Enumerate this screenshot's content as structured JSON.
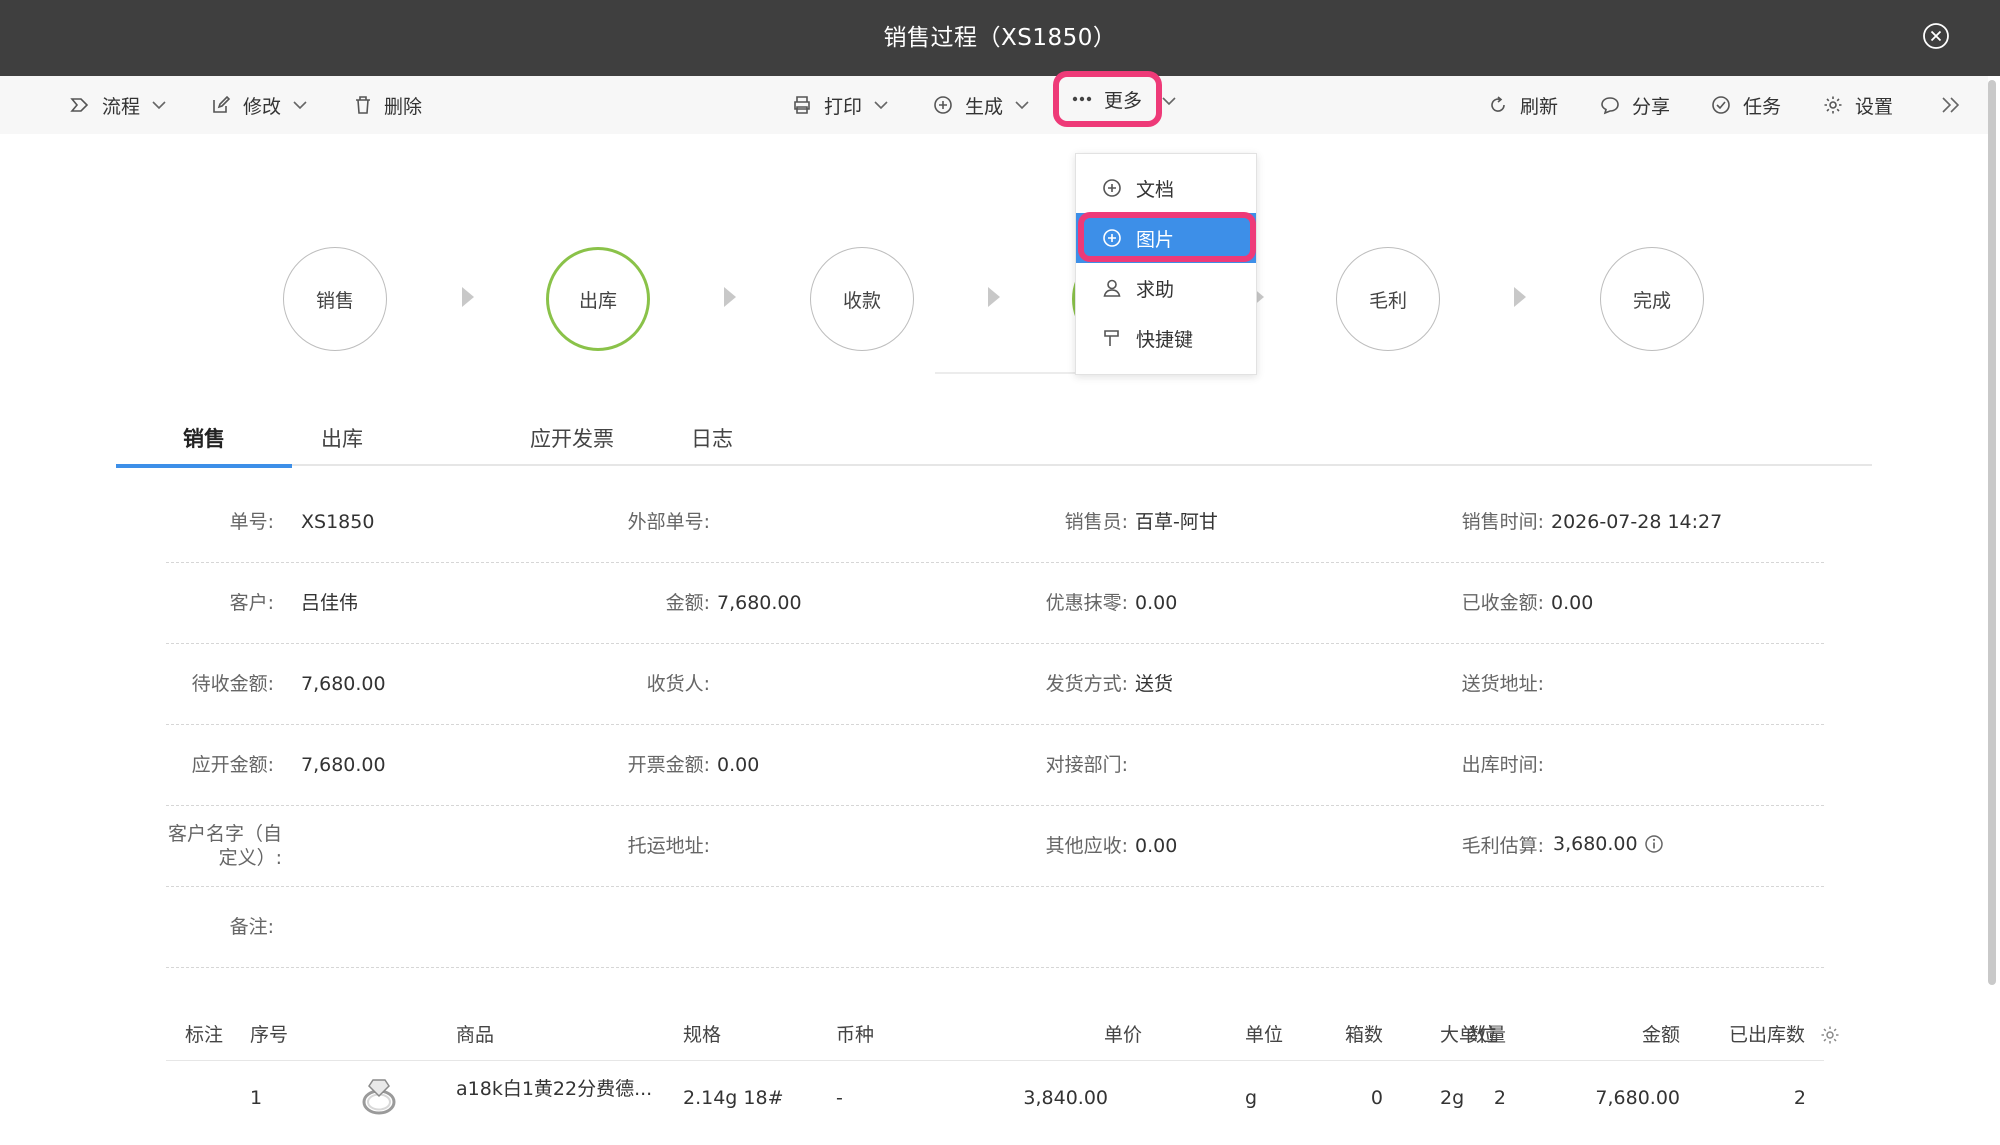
{
  "window": {
    "title": "销售过程（XS1850）"
  },
  "toolbar": {
    "flow": "流程",
    "edit": "修改",
    "delete": "删除",
    "print": "打印",
    "generate": "生成",
    "more": "更多",
    "refresh": "刷新",
    "share": "分享",
    "task": "任务",
    "settings": "设置"
  },
  "more_menu": {
    "items": [
      {
        "label": "文档",
        "icon": "plus-circle-icon"
      },
      {
        "label": "图片",
        "icon": "plus-circle-icon",
        "active": true
      },
      {
        "label": "求助",
        "icon": "person-icon"
      },
      {
        "label": "快捷键",
        "icon": "hammer-icon"
      }
    ]
  },
  "steps": [
    {
      "label": "销售"
    },
    {
      "label": "出库",
      "current": true
    },
    {
      "label": "收款"
    },
    {
      "label": ""
    },
    {
      "label": "毛利"
    },
    {
      "label": "完成"
    }
  ],
  "tabs": [
    "销售",
    "出库",
    "应开发票",
    "日志"
  ],
  "form": {
    "order_no_label": "单号:",
    "order_no": "XS1850",
    "ext_no_label": "外部单号:",
    "ext_no": "",
    "salesperson_label": "销售员:",
    "salesperson": "百草-阿甘",
    "sale_time_label": "销售时间:",
    "sale_time": "2026-07-28 14:27",
    "customer_label": "客户:",
    "customer": "吕佳伟",
    "amount_label": "金额:",
    "amount": "7,680.00",
    "discount_label": "优惠抹零:",
    "discount": "0.00",
    "received_label": "已收金额:",
    "received": "0.00",
    "pending_label": "待收金额:",
    "pending": "7,680.00",
    "consignee_label": "收货人:",
    "consignee": "",
    "ship_method_label": "发货方式:",
    "ship_method": "送货",
    "ship_addr_label": "送货地址:",
    "ship_addr": "",
    "invoice_due_label": "应开金额:",
    "invoice_due": "7,680.00",
    "invoiced_label": "开票金额:",
    "invoiced": "0.00",
    "dept_label": "对接部门:",
    "dept": "",
    "out_time_label": "出库时间:",
    "out_time": "",
    "cust_name_label_1": "客户名字（自",
    "cust_name_label_2": "定义）:",
    "cust_name": "",
    "freight_addr_label": "托运地址:",
    "freight_addr": "",
    "other_recv_label": "其他应收:",
    "other_recv": "0.00",
    "gross_label": "毛利估算:",
    "gross": "3,680.00",
    "remark_label": "备注:",
    "remark": ""
  },
  "table": {
    "headers": {
      "mark": "标注",
      "seq": "序号",
      "product": "商品",
      "spec": "规格",
      "currency": "币种",
      "price": "单价",
      "unit": "单位",
      "boxes": "箱数",
      "qty": "数量",
      "big_unit": "大单位",
      "amount": "金额",
      "shipped": "已出库数"
    },
    "rows": [
      {
        "seq": "1",
        "product": "a18k白1黄22分费德...",
        "spec": "2.14g 18#",
        "currency": "-",
        "price": "3,840.00",
        "unit": "g",
        "boxes": "0",
        "qty": "2",
        "big_unit": "2g",
        "amount": "7,680.00",
        "shipped": "2"
      }
    ]
  },
  "colors": {
    "accent": "#3d8fe8",
    "highlight": "#ee3a78",
    "current_step": "#8ac249",
    "titlebar": "#3f3f3f"
  }
}
